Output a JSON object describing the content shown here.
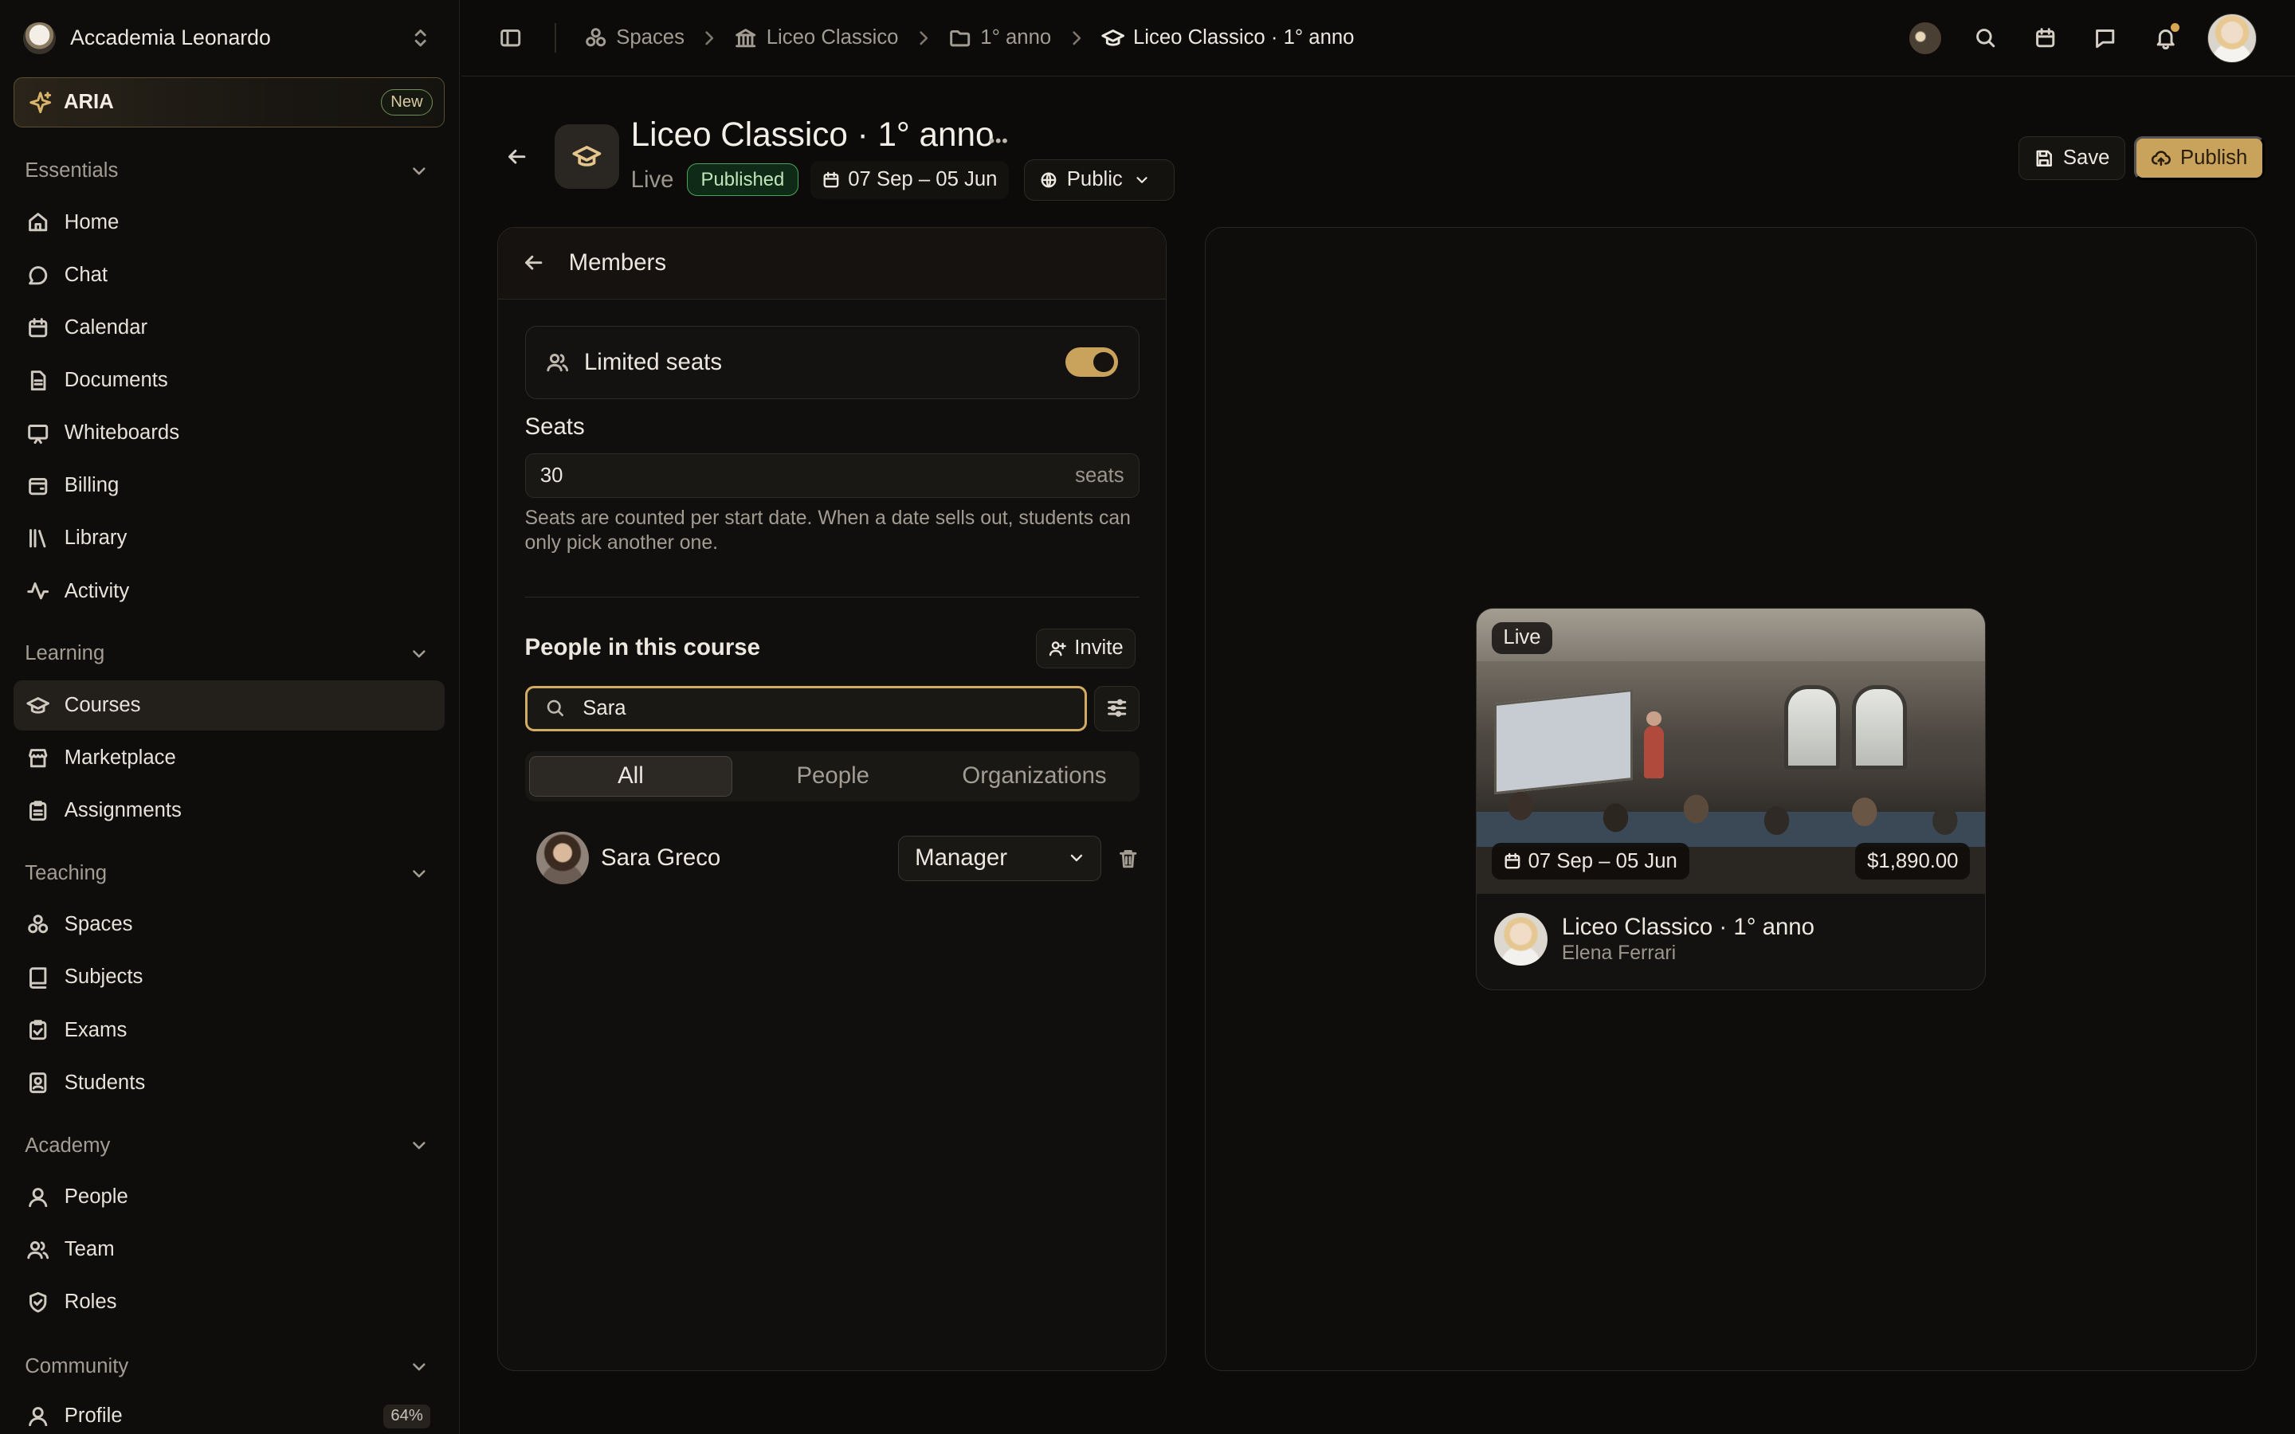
{
  "org": {
    "name": "Accademia Leonardo"
  },
  "aria": {
    "label": "ARIA",
    "badge": "New"
  },
  "sidebar": {
    "essentials": {
      "title": "Essentials",
      "items": [
        "Home",
        "Chat",
        "Calendar",
        "Documents",
        "Whiteboards",
        "Billing",
        "Library",
        "Activity"
      ]
    },
    "learning": {
      "title": "Learning",
      "items": [
        "Courses",
        "Marketplace",
        "Assignments"
      ]
    },
    "teaching": {
      "title": "Teaching",
      "items": [
        "Spaces",
        "Subjects",
        "Exams",
        "Students"
      ]
    },
    "academy": {
      "title": "Academy",
      "items": [
        "People",
        "Team",
        "Roles"
      ]
    },
    "community": {
      "title": "Community",
      "items": [
        "Profile"
      ],
      "profile_progress": "64%"
    },
    "active_item": "Courses"
  },
  "breadcrumbs": [
    "Spaces",
    "Liceo Classico",
    "1° anno",
    "Liceo Classico · 1° anno"
  ],
  "header": {
    "title": "Liceo Classico · 1° anno",
    "live": "Live",
    "status": "Published",
    "dates": "07 Sep – 05 Jun",
    "visibility": "Public",
    "save": "Save",
    "publish": "Publish"
  },
  "members": {
    "title": "Members",
    "limited_seats": "Limited seats",
    "limited_enabled": true,
    "seats_label": "Seats",
    "seats_value": "30",
    "seats_unit": "seats",
    "seats_help": "Seats are counted per start date. When a date sells out, students can only pick another one.",
    "people_title": "People in this course",
    "invite": "Invite",
    "search_value": "Sara",
    "tabs": [
      "All",
      "People",
      "Organizations"
    ],
    "active_tab": "All",
    "list": [
      {
        "name": "Sara Greco",
        "role": "Manager"
      }
    ]
  },
  "preview": {
    "badge": "Live",
    "dates": "07 Sep – 05 Jun",
    "price": "$1,890.00",
    "title": "Liceo Classico · 1° anno",
    "teacher": "Elena Ferrari"
  },
  "colors": {
    "accent": "#c9a25c",
    "published": "#4aa35a",
    "background": "#0c0b0a"
  }
}
